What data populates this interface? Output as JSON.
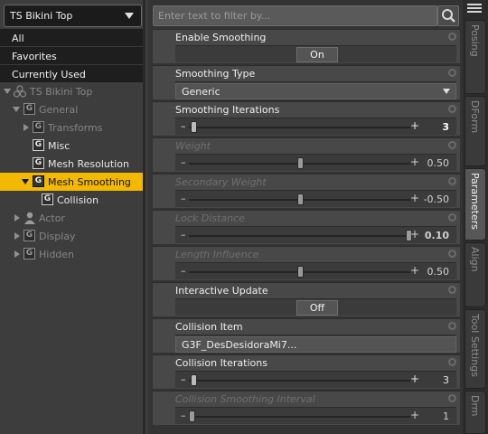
{
  "node_selector": {
    "value": "TS Bikini Top"
  },
  "filters": [
    "All",
    "Favorites",
    "Currently Used"
  ],
  "tree": {
    "root": "TS Bikini Top",
    "general": "General",
    "transforms": "Transforms",
    "misc": "Misc",
    "mesh_resolution": "Mesh Resolution",
    "mesh_smoothing": "Mesh Smoothing",
    "collision": "Collision",
    "actor": "Actor",
    "display": "Display",
    "hidden": "Hidden",
    "group_glyph": "G"
  },
  "search": {
    "placeholder": "Enter text to filter by..."
  },
  "params": {
    "enable_smoothing": {
      "label": "Enable Smoothing",
      "value": "On"
    },
    "smoothing_type": {
      "label": "Smoothing Type",
      "value": "Generic"
    },
    "smoothing_iterations": {
      "label": "Smoothing Iterations",
      "value": "3",
      "fraction": 0.01
    },
    "weight": {
      "label": "Weight",
      "value": "0.50",
      "fraction": 0.5
    },
    "secondary_weight": {
      "label": "Secondary Weight",
      "value": "-0.50",
      "fraction": 0.5
    },
    "lock_distance": {
      "label": "Lock Distance",
      "value": "0.10",
      "fraction": 1.0
    },
    "length_influence": {
      "label": "Length Influence",
      "value": "0.50",
      "fraction": 0.5
    },
    "interactive_update": {
      "label": "Interactive Update",
      "value": "Off"
    },
    "collision_item": {
      "label": "Collision Item",
      "value": "G3F_DesDesidoraMi7..."
    },
    "collision_iterations": {
      "label": "Collision Iterations",
      "value": "3",
      "fraction": 0.01
    },
    "collision_smoothing_interval": {
      "label": "Collision Smoothing Interval",
      "value": "1",
      "fraction": 0.0
    }
  },
  "slider_symbols": {
    "minus": "–",
    "plus": "+"
  },
  "tabs": [
    "Posing",
    "DForm",
    "Parameters",
    "Align",
    "Tool Settings",
    "Drm"
  ],
  "active_tab": "Parameters",
  "colors": {
    "selection": "#f3b800",
    "panel": "#484848",
    "background": "#333333"
  }
}
